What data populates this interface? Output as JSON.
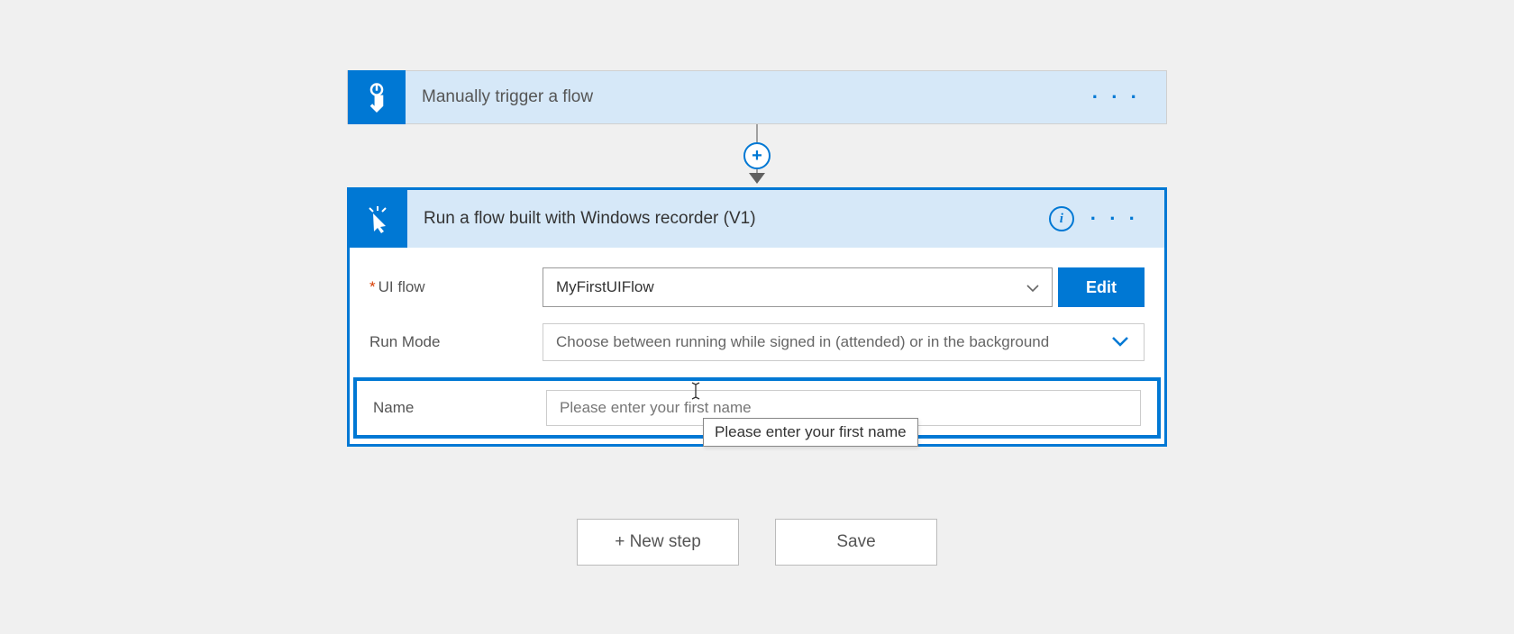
{
  "trigger": {
    "title": "Manually trigger a flow",
    "menu": "· · ·"
  },
  "addStep": {
    "plus": "+"
  },
  "action": {
    "title": "Run a flow built with Windows recorder (V1)",
    "info": "i",
    "menu": "· · ·"
  },
  "fields": {
    "uiflow": {
      "label": "UI flow",
      "value": "MyFirstUIFlow",
      "editButton": "Edit"
    },
    "runmode": {
      "label": "Run Mode",
      "placeholder": "Choose between running while signed in (attended) or in the background"
    },
    "name": {
      "label": "Name",
      "placeholder": "Please enter your first name"
    }
  },
  "tooltip": "Please enter your first name",
  "buttons": {
    "newStep": "+ New step",
    "save": "Save"
  }
}
